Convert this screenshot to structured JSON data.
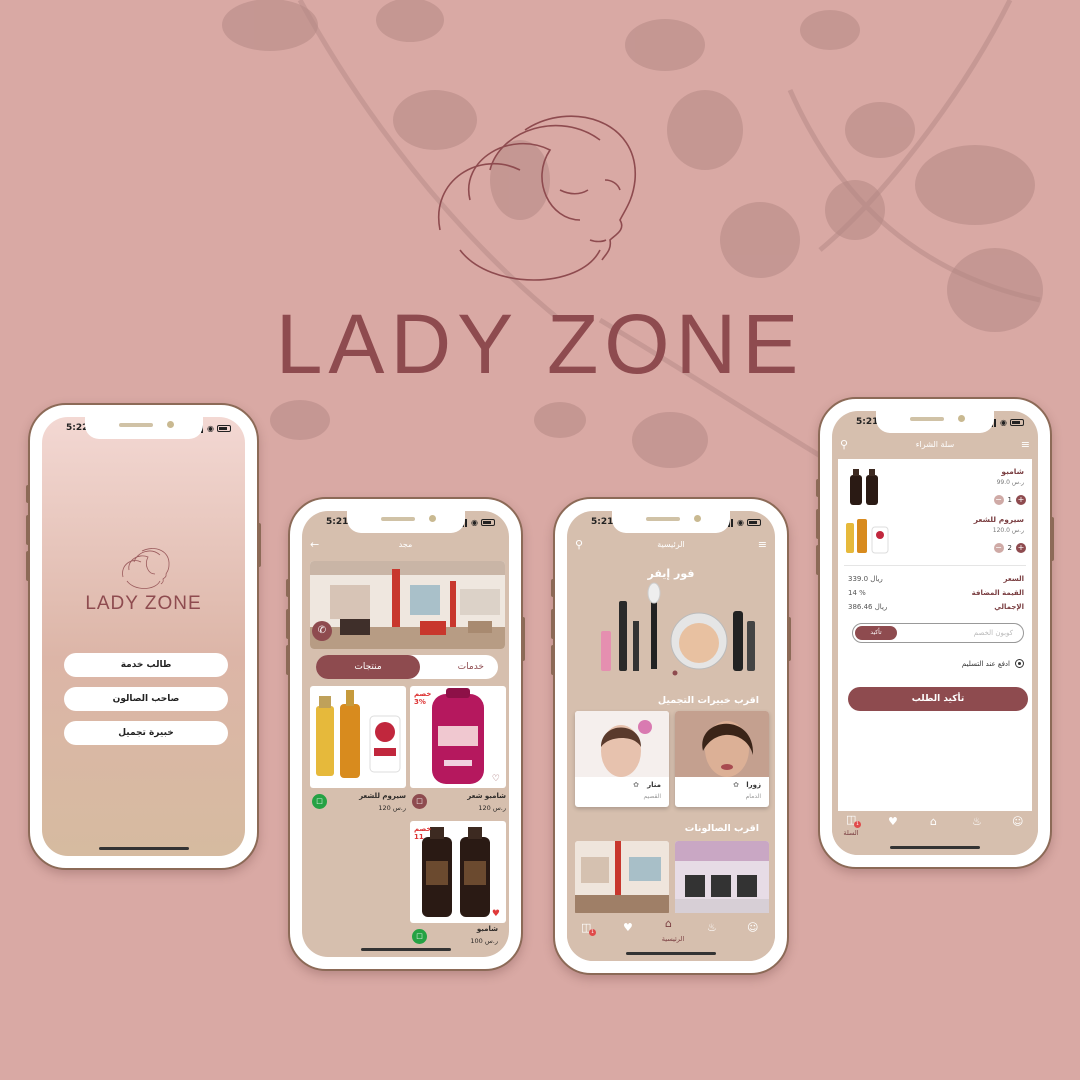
{
  "brand": {
    "name": "LADY ZONE"
  },
  "status_bar": {
    "time_a": "5:22",
    "time_b": "5:21"
  },
  "welcome": {
    "brand": "LADY ZONE",
    "buttons": [
      {
        "label": "طالب خدمة"
      },
      {
        "label": "صاحب الصالون"
      },
      {
        "label": "خبيرة تجميل"
      }
    ]
  },
  "salon_screen": {
    "title": "مجد",
    "tabs": {
      "active": "منتجات",
      "inactive": "خدمات"
    },
    "products": [
      {
        "name": "سيروم للشعر",
        "price": "120 ر.س"
      },
      {
        "name": "شامبو شعر",
        "price": "120 ر.س",
        "discount_label": "خصم",
        "discount_value": "3%"
      },
      {
        "name": "شامبو",
        "price": "100 ر.س",
        "discount_label": "خصم",
        "discount_value": "11"
      }
    ]
  },
  "home_screen": {
    "title": "الرئيسية",
    "offer_title": "فور إيفر",
    "experts_title": "اقرب خبيرات التجميل",
    "experts": [
      {
        "name": "منار",
        "sub": "القصيم"
      },
      {
        "name": "زورا",
        "sub": "الدمام"
      }
    ],
    "salons_title": "اقرب الصالونات",
    "tab_home_label": "الرئيسية",
    "cart_badge": "1"
  },
  "cart_screen": {
    "title": "سلة الشراء",
    "items": [
      {
        "name": "شامبو",
        "price": "99.0 ر.س",
        "qty": "1"
      },
      {
        "name": "سيروم للشعر",
        "price": "120.0 ر.س",
        "qty": "2"
      }
    ],
    "summary": [
      {
        "label": "السعر",
        "value": "339.0 ريال"
      },
      {
        "label": "القيمة المضافة",
        "value": "14 %"
      },
      {
        "label": "الإجمالي",
        "value": "386.46 ريال"
      }
    ],
    "coupon": {
      "placeholder": "كوبون الخصم",
      "apply": "تأكيد"
    },
    "payment_option": "ادفع عند التسليم",
    "confirm": "تأكيد الطلب",
    "tab_cart_label": "السلة",
    "cart_badge": "1"
  },
  "colors": {
    "background": "#d9a9a4",
    "brand": "#8e4b4f",
    "screen_beige": "#d6bfae",
    "whatsapp_green": "#25a244"
  },
  "icons": [
    "search-icon",
    "filter-icon",
    "back-arrow-icon",
    "whatsapp-icon",
    "heart-icon",
    "cart-icon",
    "home-icon",
    "bell-icon",
    "user-icon",
    "shopping-bag-icon"
  ]
}
